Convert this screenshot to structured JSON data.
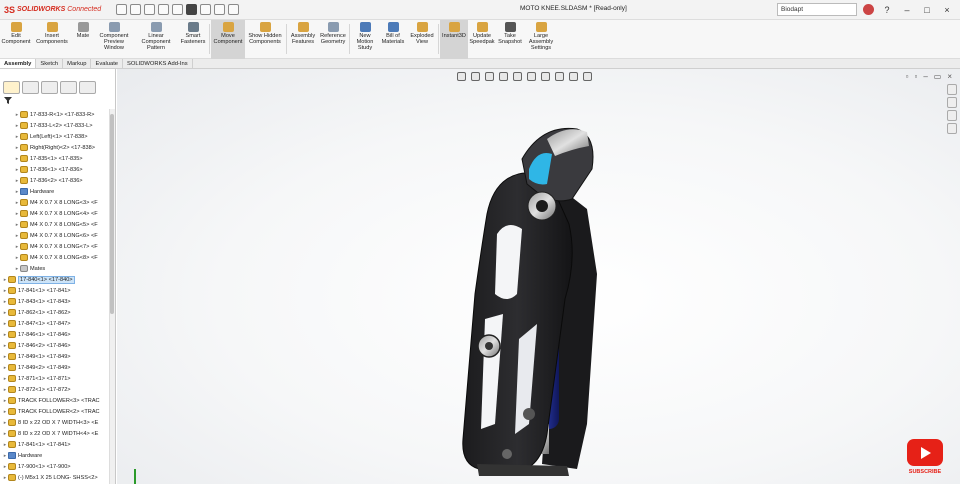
{
  "app": {
    "ds": "3S",
    "brand": "SOLIDWORKS",
    "connected": "Connected"
  },
  "document_title": "MOTO KNEE.SLDASM * [Read-only]",
  "search": {
    "value": "Biodapt"
  },
  "command_manager": [
    {
      "label": "Edit Component",
      "color": "#d9a441"
    },
    {
      "label": "Insert Components",
      "color": "#d9a441"
    },
    {
      "label": "Mate",
      "color": "#999999"
    },
    {
      "label": "Component Preview Window",
      "color": "#8a9bb0"
    },
    {
      "label": "Linear Component Pattern",
      "color": "#8a9bb0"
    },
    {
      "label": "Smart Fasteners",
      "color": "#6a7b8a"
    },
    {
      "label": "Move Component",
      "color": "#d9a441",
      "active": true
    },
    {
      "label": "Show Hidden Components",
      "color": "#d9a441"
    },
    {
      "label": "Assembly Features",
      "color": "#d9a441"
    },
    {
      "label": "Reference Geometry",
      "color": "#8a9bb0"
    },
    {
      "label": "New Motion Study",
      "color": "#4c7ab8"
    },
    {
      "label": "Bill of Materials",
      "color": "#4c7ab8"
    },
    {
      "label": "Exploded View",
      "color": "#d9a441"
    },
    {
      "label": "Instant3D",
      "color": "#d9a441",
      "active": true
    },
    {
      "label": "Update Speedpak",
      "color": "#d9a441"
    },
    {
      "label": "Take Snapshot",
      "color": "#555555"
    },
    {
      "label": "Large Assembly Settings",
      "color": "#d9a441"
    }
  ],
  "tabs": [
    {
      "label": "Assembly",
      "active": true
    },
    {
      "label": "Sketch"
    },
    {
      "label": "Markup"
    },
    {
      "label": "Evaluate"
    },
    {
      "label": "SOLIDWORKS Add-Ins"
    }
  ],
  "tree": [
    {
      "label": "17-833-R<1> <17-833-R>",
      "indent": 2,
      "icon": "part"
    },
    {
      "label": "17-833-L<2> <17-833-L>",
      "indent": 2,
      "icon": "part"
    },
    {
      "label": "Left(Left)<1> <17-838>",
      "indent": 2,
      "icon": "part"
    },
    {
      "label": "Right(Right)<2> <17-838>",
      "indent": 2,
      "icon": "part"
    },
    {
      "label": "17-835<1> <17-835>",
      "indent": 2,
      "icon": "part"
    },
    {
      "label": "17-836<1> <17-836>",
      "indent": 2,
      "icon": "part"
    },
    {
      "label": "17-836<2> <17-836>",
      "indent": 2,
      "icon": "part"
    },
    {
      "label": "Hardware",
      "indent": 2,
      "icon": "folder"
    },
    {
      "label": "M4 X 0.7 X 8 LONG<3> <F",
      "indent": 2,
      "icon": "part"
    },
    {
      "label": "M4 X 0.7 X 8 LONG<4> <F",
      "indent": 2,
      "icon": "part"
    },
    {
      "label": "M4 X 0.7 X 8 LONG<5> <F",
      "indent": 2,
      "icon": "part"
    },
    {
      "label": "M4 X 0.7 X 8 LONG<6> <F",
      "indent": 2,
      "icon": "part"
    },
    {
      "label": "M4 X 0.7 X 8 LONG<7> <F",
      "indent": 2,
      "icon": "part"
    },
    {
      "label": "M4 X 0.7 X 8 LONG<8> <F",
      "indent": 2,
      "icon": "part"
    },
    {
      "label": "Mates",
      "indent": 2,
      "icon": "mates"
    },
    {
      "label": "17-840<1> <17-840>",
      "indent": 0,
      "icon": "part",
      "selected": true
    },
    {
      "label": "17-841<1> <17-841>",
      "indent": 0,
      "icon": "part"
    },
    {
      "label": "17-843<1> <17-843>",
      "indent": 0,
      "icon": "part"
    },
    {
      "label": "17-862<1> <17-862>",
      "indent": 0,
      "icon": "part"
    },
    {
      "label": "17-847<1> <17-847>",
      "indent": 0,
      "icon": "part"
    },
    {
      "label": "17-846<1> <17-846>",
      "indent": 0,
      "icon": "part"
    },
    {
      "label": "17-846<2> <17-846>",
      "indent": 0,
      "icon": "part"
    },
    {
      "label": "17-849<1> <17-849>",
      "indent": 0,
      "icon": "part"
    },
    {
      "label": "17-849<2> <17-849>",
      "indent": 0,
      "icon": "part"
    },
    {
      "label": "17-871<1> <17-871>",
      "indent": 0,
      "icon": "part"
    },
    {
      "label": "17-872<1> <17-872>",
      "indent": 0,
      "icon": "part"
    },
    {
      "label": "TRACK FOLLOWER<3> <TRAC",
      "indent": 0,
      "icon": "part"
    },
    {
      "label": "TRACK FOLLOWER<2> <TRAC",
      "indent": 0,
      "icon": "part"
    },
    {
      "label": "8 ID x 22 OD X 7 WIDTH<3> <E",
      "indent": 0,
      "icon": "part"
    },
    {
      "label": "8 ID x 22 OD X 7 WIDTH<4> <E",
      "indent": 0,
      "icon": "part"
    },
    {
      "label": "17-841<1> <17-841>",
      "indent": 0,
      "icon": "part"
    },
    {
      "label": "Hardware",
      "indent": 0,
      "icon": "folder"
    },
    {
      "label": "17-900<1> <17-900>",
      "indent": 0,
      "icon": "part"
    },
    {
      "label": "(-) M5x1 X 25 LONG- SHSS<2>",
      "indent": 0,
      "icon": "part"
    }
  ],
  "youtube": {
    "label": "SUBSCRIBE"
  },
  "colors": {
    "accent": "#d52b1e",
    "part_cyan": "#2fb6e6",
    "shock_blue": "#2436a8"
  }
}
